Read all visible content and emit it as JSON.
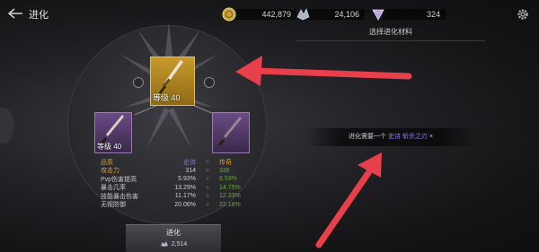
{
  "header": {
    "title": "进化"
  },
  "currencies": [
    {
      "icon": "gold-coin-icon",
      "value": "442,879"
    },
    {
      "icon": "crystal-icon",
      "value": "24,106"
    },
    {
      "icon": "gem-icon",
      "value": "324"
    }
  ],
  "materials": {
    "title": "选择进化材料"
  },
  "main_item": {
    "level": "等级 40"
  },
  "side_item": {
    "level": "等级 40"
  },
  "stats": {
    "header": {
      "label": "品质",
      "current": "史诗",
      "next": "传奇"
    },
    "rows": [
      {
        "label": "攻击力",
        "current": "314",
        "next": "336"
      },
      {
        "label": "Pvp伤害提高",
        "current": "5.93%",
        "next": "6.53%"
      },
      {
        "label": "暴击几率",
        "current": "13.29%",
        "next": "14.75%"
      },
      {
        "label": "技能暴击伤害",
        "current": "11.17%",
        "next": "12.33%"
      },
      {
        "label": "无视防御",
        "current": "20.06%",
        "next": "22.18%"
      }
    ],
    "arrow": "»"
  },
  "evolve_button": {
    "label": "进化",
    "cost": "2,514"
  },
  "requirement": {
    "prefix": "进化需要一个",
    "item": "史诗 斩杀之刃",
    "suffix": "×"
  },
  "colors": {
    "accent_arrow": "#e8404a",
    "legendary": "#e0a020",
    "epic": "#9a6ad6",
    "stat_green": "#6aa83c"
  }
}
